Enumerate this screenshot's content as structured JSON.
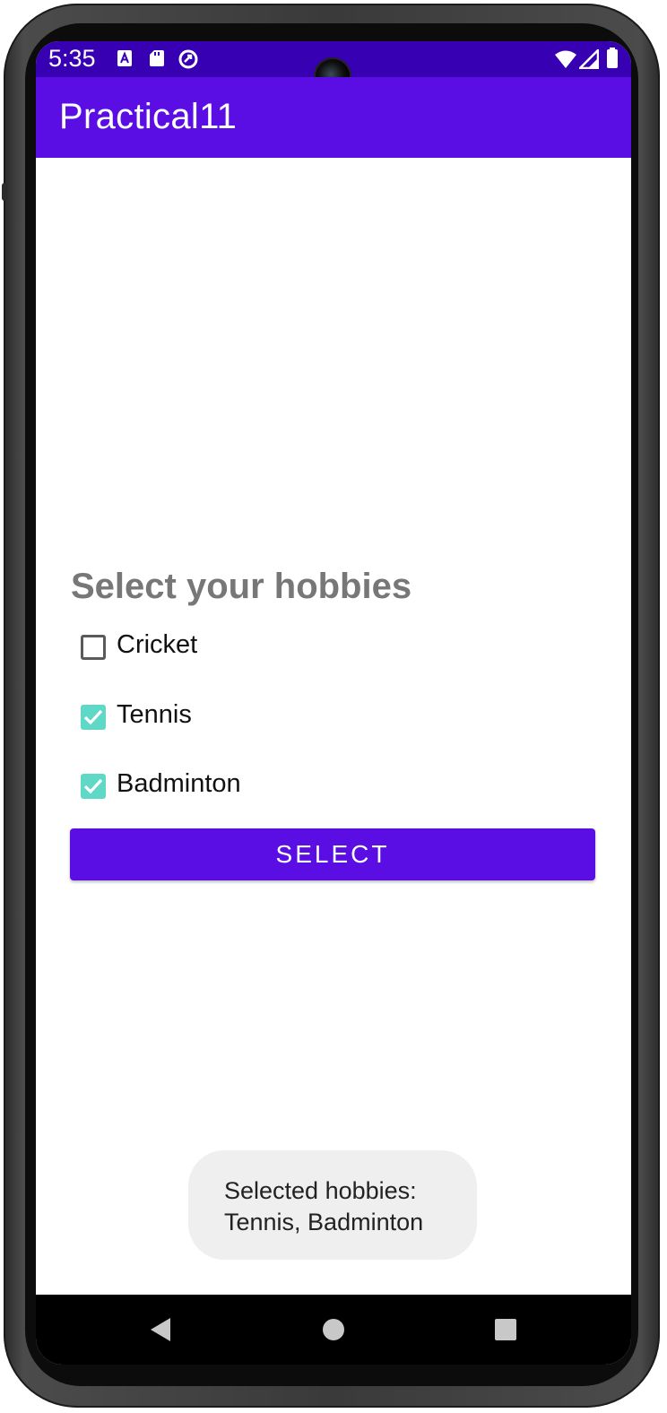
{
  "status_bar": {
    "time": "5:35",
    "left_icons": [
      "text-a-icon",
      "sd-card-icon",
      "data-saver-icon"
    ],
    "right_icons": [
      "wifi-icon",
      "signal-icon",
      "battery-icon"
    ],
    "background": "#3700b3"
  },
  "app_bar": {
    "title": "Practical11",
    "background": "#5b0ee3"
  },
  "main": {
    "heading": "Select your hobbies",
    "hobbies": [
      {
        "label": "Cricket",
        "checked": false
      },
      {
        "label": "Tennis",
        "checked": true
      },
      {
        "label": "Badminton",
        "checked": true
      }
    ],
    "select_button": "SELECT",
    "accent_color": "#5fd8c8"
  },
  "toast": {
    "line1": "Selected hobbies:",
    "line2": "Tennis, Badminton"
  },
  "nav_bar": {
    "buttons": [
      "back-icon",
      "home-icon",
      "recents-icon"
    ]
  }
}
